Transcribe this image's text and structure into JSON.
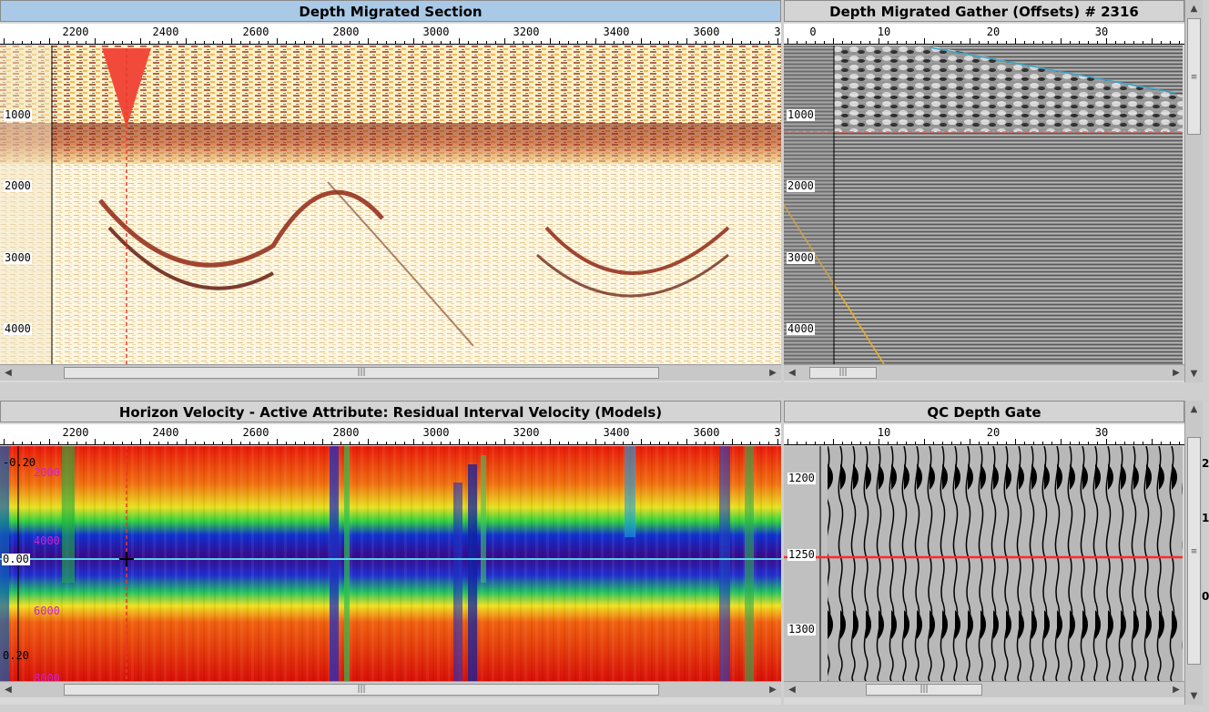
{
  "panels": {
    "section": {
      "title": "Depth Migrated Section",
      "x_ticks": [
        "2200",
        "2400",
        "2600",
        "2800",
        "3000",
        "3200",
        "3400",
        "3600",
        "3"
      ],
      "y_ticks": [
        "1000",
        "2000",
        "3000",
        "4000"
      ]
    },
    "gather": {
      "title": "Depth Migrated Gather (Offsets) # 2316",
      "x_ticks": [
        "0",
        "10",
        "20",
        "30"
      ],
      "y_ticks": [
        "1000",
        "2000",
        "3000",
        "4000"
      ]
    },
    "horizon": {
      "title": "Horizon Velocity - Active Attribute: Residual Interval Velocity (Models)",
      "x_ticks": [
        "2200",
        "2400",
        "2600",
        "2800",
        "3000",
        "3200",
        "3400",
        "3600",
        "3"
      ],
      "residual_ticks": [
        "-0.20",
        "0.00",
        "0.20"
      ],
      "velocity_ticks": [
        "2000",
        "4000",
        "6000",
        "8000"
      ]
    },
    "qc": {
      "title": "QC Depth Gate",
      "x_ticks": [
        "10",
        "20",
        "30"
      ],
      "y_ticks": [
        "1200",
        "1250",
        "1300"
      ]
    }
  },
  "edge_marks": [
    "2",
    "1",
    "0"
  ],
  "colors": {
    "active_title": "#a9c9e6",
    "velocity_red": "#e01010",
    "velocity_blue": "#2020c0",
    "picked_line": "#ff2a2a"
  }
}
